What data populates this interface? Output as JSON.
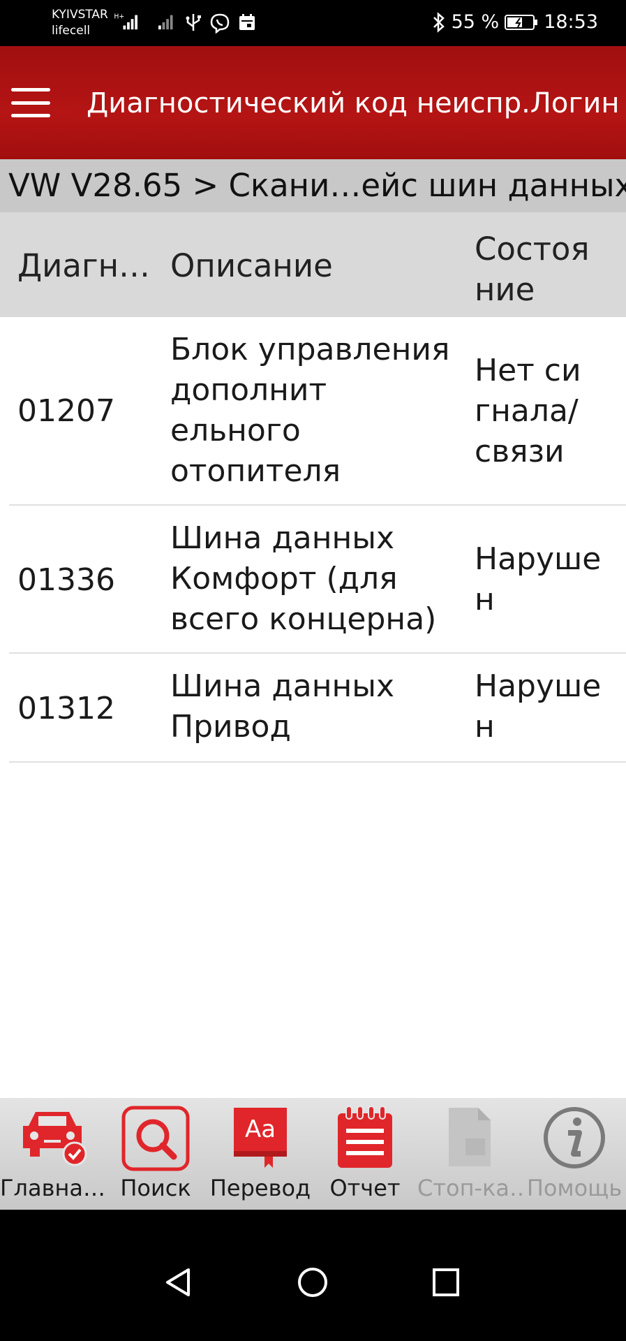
{
  "status_bar": {
    "carrier_1": "KYIVSTAR",
    "carrier_2": "lifecell",
    "battery": "55 %",
    "time": "18:53"
  },
  "app_bar": {
    "title": "Диагностический код неиспр.Логин"
  },
  "breadcrumb": "VW V28.65 > Скани…ейс шин данных",
  "table": {
    "headers": {
      "code": "Диагн…",
      "description": "Описание",
      "status_line1": "Состоя",
      "status_line2": "ние"
    },
    "rows": [
      {
        "code": "01207",
        "description": [
          "Блок управления",
          "дополнит",
          "ельного",
          "отопителя"
        ],
        "status": [
          "Нет си",
          "гнала/",
          "связи"
        ]
      },
      {
        "code": "01336",
        "description": [
          "Шина данных",
          "Комфорт (для",
          "всего концерна)"
        ],
        "status": [
          "Наруше",
          "н"
        ]
      },
      {
        "code": "01312",
        "description": [
          "Шина данных",
          "Привод"
        ],
        "status": [
          "Наруше",
          "н"
        ]
      }
    ]
  },
  "toolbar": {
    "items": [
      {
        "label": "Главна…",
        "icon": "car-check-icon",
        "enabled": true
      },
      {
        "label": "Поиск",
        "icon": "search-icon",
        "enabled": true
      },
      {
        "label": "Перевод",
        "icon": "translate-book-icon",
        "enabled": true
      },
      {
        "label": "Отчет",
        "icon": "report-notepad-icon",
        "enabled": true
      },
      {
        "label": "Стоп-ка…",
        "icon": "document-icon",
        "enabled": false
      },
      {
        "label": "Помощь",
        "icon": "info-icon",
        "enabled": false
      }
    ]
  },
  "colors": {
    "accent": "#b51414",
    "icon_red": "#e0262a",
    "disabled_gray": "#9a9a9a"
  }
}
